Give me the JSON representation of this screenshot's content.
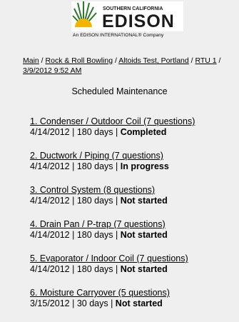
{
  "logo": {
    "line1": "SOUTHERN CALIFORNIA",
    "line2": "EDISON",
    "tagline": "An EDISON INTERNATIONAL® Company",
    "sun_color": "#f4b400",
    "ray_color": "#2b7a2b",
    "text_color": "#1a1a1a"
  },
  "breadcrumb": {
    "items": [
      "Main",
      "Rock & Roll Bowling",
      "Altoids Test, Portland",
      "RTU 1"
    ],
    "separator": " / ",
    "current": "3/9/2012 9:52 AM"
  },
  "page_title": "Scheduled Maintenance",
  "tasks": [
    {
      "title": "1. Condenser / Outdoor Coil (7 questions)",
      "date": "4/14/2012",
      "interval": "180 days",
      "status": "Completed"
    },
    {
      "title": "2. Ductwork / Piping (7 questions)",
      "date": "4/14/2012",
      "interval": "180 days",
      "status": "In progress"
    },
    {
      "title": "3. Control System (8 questions)",
      "date": "4/14/2012",
      "interval": "180 days",
      "status": "Not started"
    },
    {
      "title": "4. Drain Pan / P-trap (7 questions)",
      "date": "4/14/2012",
      "interval": "180 days",
      "status": "Not started"
    },
    {
      "title": "5. Evaporator / Indoor Coil (7 questions)",
      "date": "4/14/2012",
      "interval": "180 days",
      "status": "Not started"
    },
    {
      "title": "6. Moisture Carryover (5 questions)",
      "date": "3/15/2012",
      "interval": "30 days",
      "status": "Not started"
    }
  ],
  "field_separator": " | "
}
